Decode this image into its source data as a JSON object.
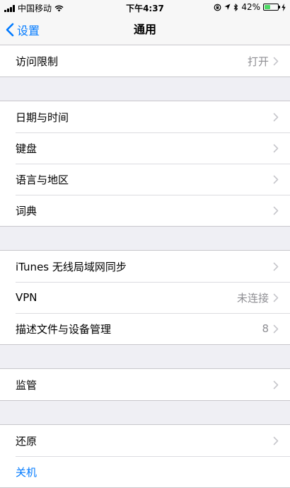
{
  "status_bar": {
    "carrier": "中国移动",
    "time": "下午4:37",
    "battery_percent_text": "42%",
    "battery_level": 0.42
  },
  "nav": {
    "back_label": "设置",
    "title": "通用"
  },
  "groups": [
    {
      "items": [
        {
          "label": "访问限制",
          "value": "打开"
        }
      ]
    },
    {
      "items": [
        {
          "label": "日期与时间"
        },
        {
          "label": "键盘"
        },
        {
          "label": "语言与地区"
        },
        {
          "label": "词典"
        }
      ]
    },
    {
      "items": [
        {
          "label": "iTunes 无线局域网同步"
        },
        {
          "label": "VPN",
          "value": "未连接"
        },
        {
          "label": "描述文件与设备管理",
          "value": "8"
        }
      ]
    },
    {
      "items": [
        {
          "label": "监管"
        }
      ]
    },
    {
      "items": [
        {
          "label": "还原"
        },
        {
          "label": "关机"
        }
      ]
    }
  ],
  "colors": {
    "accent": "#007aff",
    "secondary_text": "#8e8e93",
    "background": "#efeff4",
    "battery": "#4cd964"
  }
}
